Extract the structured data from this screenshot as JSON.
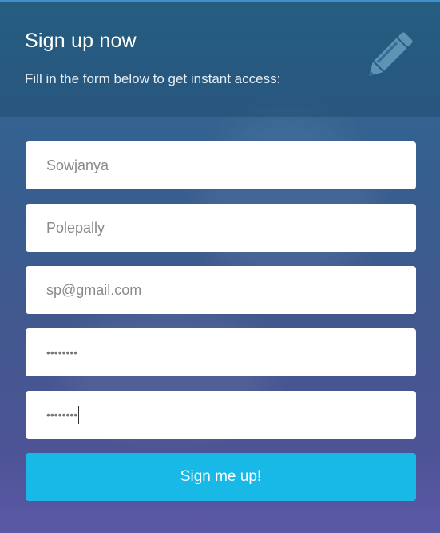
{
  "header": {
    "title": "Sign up now",
    "subtitle": "Fill in the form below to get instant access:",
    "icon": "pencil-icon"
  },
  "form": {
    "first_name": {
      "value": "Sowjanya"
    },
    "last_name": {
      "value": "Polepally"
    },
    "email": {
      "value": "sp@gmail.com"
    },
    "password": {
      "value": "••••••••"
    },
    "confirm_password": {
      "value": "••••••••"
    },
    "submit_label": "Sign me up!"
  },
  "colors": {
    "accent": "#19b9e7",
    "text_light": "#ffffff"
  }
}
